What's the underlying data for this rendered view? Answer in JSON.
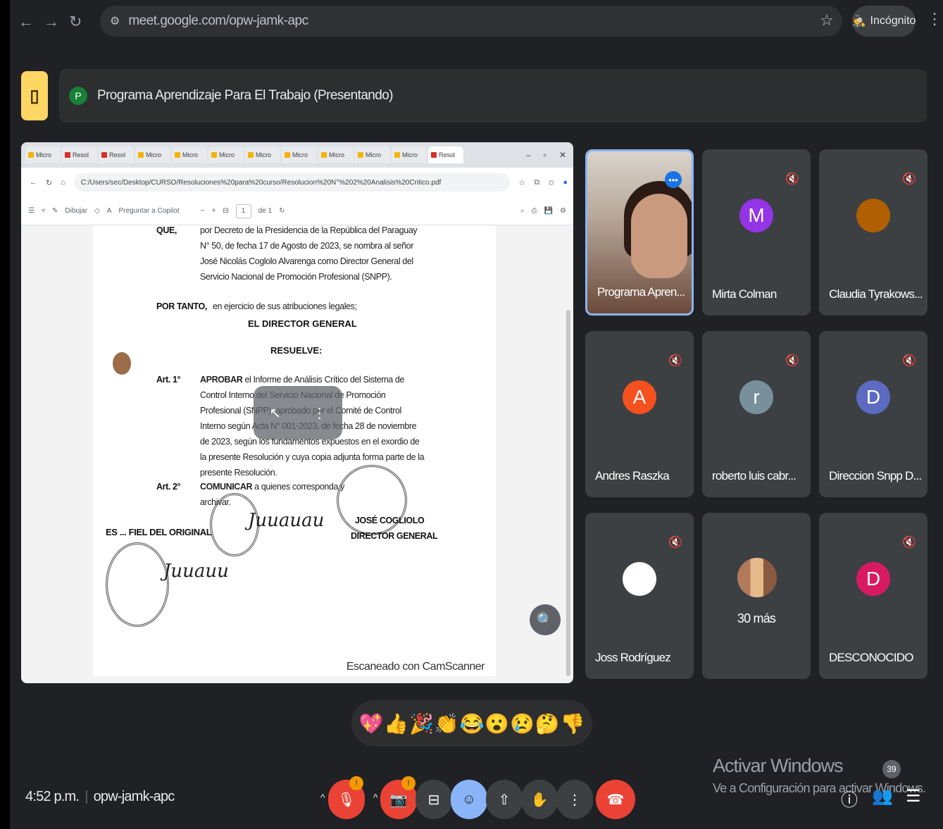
{
  "browser": {
    "url": "meet.google.com/opw-jamk-apc",
    "incognito_label": "Incógnito"
  },
  "meet": {
    "presenter_initial": "P",
    "presenting_title": "Programa Aprendizaje Para El Trabajo (Presentando)",
    "time": "4:52 p.m.",
    "meeting_code": "opw-jamk-apc",
    "participant_count": "39"
  },
  "shared_screen": {
    "tabs": [
      "Micro",
      "Resol",
      "Resol",
      "Micro",
      "Micro",
      "Micro",
      "Micro",
      "Micro",
      "Micro",
      "Micro",
      "Micro",
      "Resol"
    ],
    "address": "C:/Users/sec/Desktop/CURSO/Resoluciones%20para%20curso/Resolucion%20N°%202%20Analisis%20Critico.pdf",
    "pdf_toolbar": {
      "draw_label": "Dibujar",
      "ask_label": "Preguntar a Copilot",
      "page_current": "1",
      "page_total": "de 1"
    },
    "document": {
      "que_label": "QUE,",
      "que_text": "por Decreto de la Presidencia de la República del Paraguay N° 50, de fecha 17 de Agosto de 2023, se nombra al señor José Nicolás Coglolo Alvarenga como Director General del Servicio Nacional de Promoción Profesional (SNPP).",
      "por_tanto_label": "POR TANTO,",
      "por_tanto_text": "en ejercicio de sus atribuciones legales;",
      "director_heading": "EL DIRECTOR GENERAL",
      "resuelve_heading": "RESUELVE:",
      "art1_label": "Art. 1°",
      "art1_bold": "APROBAR",
      "art1_text": "el Informe de Análisis Crítico del Sistema de Control Interno del Servicio Nacional de Promoción Profesional (SNPP), aprobado por el Comité de Control Interno según Acta N° 001-2023, de fecha 28 de noviembre de 2023, según los fundamentos expuestos en el exordio de la presente Resolución y cuya copia adjunta forma parte de la presente Resolución.",
      "art2_label": "Art. 2°",
      "art2_bold": "COMUNICAR",
      "art2_text": "a quienes corresponda y archivar.",
      "signer_name": "JOSÉ COGLIOLO",
      "signer_title": "DIRECTOR GENERAL",
      "stamp_text": "ES ... FIEL DEL ORIGINAL",
      "signature_1": "Juuauau",
      "signature_2": "Juuauu",
      "footer_text": "Escaneado con CamScanner"
    }
  },
  "participants": [
    {
      "name": "Programa Apren...",
      "initial": "",
      "color": "",
      "speaking": true
    },
    {
      "name": "Mirta Colman",
      "initial": "M",
      "color": "#9334e6"
    },
    {
      "name": "Claudia Tyrakows...",
      "initial": "",
      "color": "#b06000"
    },
    {
      "name": "Andres Raszka",
      "initial": "A",
      "color": "#f4511e"
    },
    {
      "name": "roberto luis cabr...",
      "initial": "r",
      "color": "#78909c"
    },
    {
      "name": "Direccion Snpp D...",
      "initial": "D",
      "color": "#5c6bc0"
    },
    {
      "name": "Joss Rodríguez",
      "initial": "",
      "color": "#ffffff"
    },
    {
      "name": "30 más",
      "initial": "",
      "color": ""
    },
    {
      "name": "DESCONOCIDO",
      "initial": "D",
      "color": "#d81b60"
    }
  ],
  "reactions": [
    "💖",
    "👍",
    "🎉",
    "👏",
    "😂",
    "😮",
    "😢",
    "🤔",
    "👎"
  ],
  "controls": {
    "mic_badge": "!",
    "cam_badge": "!"
  },
  "windows_activation": {
    "title": "Activar Windows",
    "subtitle": "Ve a Configuración para activar Windows."
  }
}
